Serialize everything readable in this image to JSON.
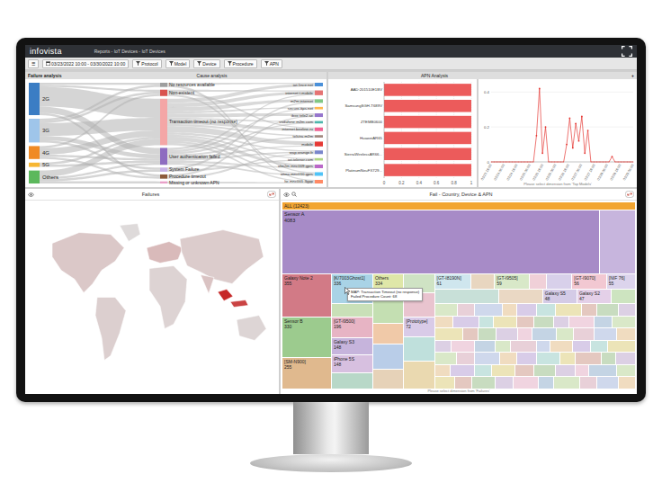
{
  "app": {
    "logo": "infovista",
    "title": "Reports - IoT Devices - IoT Devices"
  },
  "toolbar": {
    "menu": "☰",
    "date_range": "03/23/2022 10:00 - 03/30/2022 10:00",
    "filters": [
      "Protocol",
      "Model",
      "Device",
      "Procedure",
      "APN"
    ]
  },
  "sankey": {
    "title": "Failure analysis",
    "subtitle": "Cause analysis",
    "sources": [
      {
        "label": "2G",
        "color": "#3b7dc4",
        "flows": [
          1,
          1,
          9,
          3,
          0,
          1,
          0
        ]
      },
      {
        "label": "3G",
        "color": "#9fc5ea",
        "flows": [
          1,
          1,
          6,
          2,
          1,
          0,
          0
        ]
      },
      {
        "label": "4G",
        "color": "#f08a24",
        "flows": [
          0,
          1,
          3,
          1,
          0,
          1,
          0
        ]
      },
      {
        "label": "5G",
        "color": "#f7b733",
        "flows": [
          0,
          0,
          1,
          1,
          0,
          0,
          0
        ]
      },
      {
        "label": "Others",
        "color": "#5cb85c",
        "flows": [
          0,
          0,
          3,
          1,
          1,
          0,
          1
        ]
      }
    ],
    "causes": [
      {
        "label": "No resources available",
        "color": "#9e9e9e",
        "flows": [
          1,
          0,
          0,
          0,
          0,
          0,
          0,
          0,
          0,
          0,
          0,
          0,
          0,
          1
        ]
      },
      {
        "label": "Non-existent",
        "color": "#d9534f",
        "flows": [
          0,
          1,
          0,
          0,
          0,
          0,
          1,
          0,
          0,
          0,
          0,
          0,
          1,
          0
        ]
      },
      {
        "label": "Transaction timeout (no response)",
        "color": "#f4a6a6",
        "flows": [
          2,
          2,
          2,
          1,
          2,
          1,
          2,
          1,
          3,
          1,
          1,
          2,
          1,
          1
        ]
      },
      {
        "label": "User authentication failed",
        "color": "#8e6cc0",
        "flows": [
          0,
          1,
          0,
          1,
          0,
          1,
          0,
          1,
          1,
          1,
          0,
          1,
          1,
          0
        ]
      },
      {
        "label": "System Failure",
        "color": "#c9b3e6",
        "flows": [
          0,
          0,
          1,
          0,
          0,
          0,
          0,
          0,
          0,
          0,
          1,
          0,
          0,
          0
        ]
      },
      {
        "label": "Procedure timeout",
        "color": "#8d5a3b",
        "flows": [
          0,
          0,
          0,
          0,
          1,
          0,
          0,
          0,
          0,
          1,
          0,
          0,
          0,
          0
        ]
      },
      {
        "label": "Missing or unknown APN",
        "color": "#e8a0c8",
        "flows": [
          0,
          0,
          0,
          0,
          0,
          0,
          0,
          0,
          0,
          0,
          0,
          0,
          0,
          1
        ]
      }
    ],
    "apns": [
      {
        "label": "iot.1nce.net",
        "color": "#4a90d9"
      },
      {
        "label": "internet.t-mobile",
        "color": "#e57373"
      },
      {
        "label": "m2m.internet",
        "color": "#81c784"
      },
      {
        "label": "secure.ttps.net",
        "color": "#ffb74d"
      },
      {
        "label": "ibox.tele2.se",
        "color": "#9575cd"
      },
      {
        "label": "vodafone.m2m.com",
        "color": "#4db6ac"
      },
      {
        "label": "internet.beeline.ru",
        "color": "#f06292"
      },
      {
        "label": "telstra.m2m",
        "color": "#a1887f"
      },
      {
        "label": "mobile",
        "color": "#e53935"
      },
      {
        "label": "wap.orange.fr",
        "color": "#7986cb"
      },
      {
        "label": "iot.telenor.com",
        "color": "#aed581"
      },
      {
        "label": "vfm2m.mnc009.gprs",
        "color": "#ba68c8"
      },
      {
        "label": "wtmx.mnc010.gprs",
        "color": "#4fc3f7"
      },
      {
        "label": "lte.mnc001.3gpp",
        "color": "#ff8a65"
      }
    ]
  },
  "apn_panel": {
    "title": "APN Analysis",
    "add": "+"
  },
  "bar_chart": {
    "labels": [
      "AAD:201510E1BV",
      "SamsungSGH-T689V",
      "ZTEMB0600",
      "HuaweiAR65",
      "SierraWirelessAR66...",
      "PlatinumNeuFX729..."
    ],
    "values": [
      1,
      1,
      1,
      1,
      1,
      1
    ],
    "ticks": [
      "0",
      "0.2",
      "0.4",
      "0.6",
      "0.8",
      "1"
    ]
  },
  "line_chart": {
    "y_ticks": [
      "0",
      "0.2",
      "0.4"
    ],
    "x_ticks": [
      "03/23 18:00",
      "03/24 06:00",
      "03/24 18:00",
      "03/25 06:00",
      "03/25 18:00",
      "03/26 06:00",
      "03/26 18:00",
      "03/27 06:00",
      "03/27 18:00",
      "03/28 06:00",
      "03/28 18:00",
      "03/29 06:00"
    ],
    "values": [
      0,
      0,
      0,
      0,
      0,
      0,
      0,
      0,
      0,
      0,
      0,
      0,
      0,
      0,
      0,
      0.15,
      0.42,
      0.05,
      0.2,
      0,
      0,
      0,
      0,
      0,
      0,
      0.1,
      0.25,
      0.08,
      0.22,
      0.12,
      0.26,
      0.05,
      0.18,
      0,
      0,
      0,
      0,
      0,
      0,
      0,
      0.03,
      0,
      0,
      0,
      0,
      0,
      0,
      0
    ],
    "caption": "Please select dimension from 'Top Models'"
  },
  "map": {
    "title": "Failures",
    "regions": [
      {
        "level": 0.12
      },
      {
        "level": 0.02
      },
      {
        "level": 0.08
      },
      {
        "level": 0.2
      },
      {
        "level": 0.06
      },
      {
        "level": 0.1
      },
      {
        "level": 0.15
      },
      {
        "level": 1
      },
      {
        "level": 0.85
      },
      {
        "level": 0.05
      }
    ]
  },
  "treemap": {
    "title": "Fail - Country, Device & APN",
    "root": "ALL (12423)",
    "top": [
      {
        "label": "Sensor A",
        "count": "4083",
        "weight": 618,
        "color": "#a78bc7"
      },
      {
        "weight": 62,
        "color": "#c7b5dd"
      }
    ],
    "columns": [
      {
        "weight": 55,
        "cells": [
          {
            "label": "Galaxy Note 2",
            "count": "355",
            "weight": 47,
            "color": "#d27a86"
          },
          {
            "label": "Sensor B",
            "count": "330",
            "weight": 44,
            "color": "#9ccb8e"
          },
          {
            "label": "[SM-N900]",
            "count": "255",
            "weight": 34,
            "color": "#e0b98e"
          }
        ]
      },
      {
        "weight": 46,
        "cells": [
          {
            "label": "[K/7003Ghost1]",
            "count": "336",
            "weight": 34,
            "color": "#a9d3e6"
          },
          {
            "weight": 14,
            "color": "#c9e0b8"
          },
          {
            "label": "[GT-I9500]",
            "count": "196",
            "weight": 22,
            "color": "#e7b4c4"
          },
          {
            "label": "Galaxy S3",
            "count": "148",
            "weight": 19,
            "color": "#c6b4dc"
          },
          {
            "label": "iPhone 5S",
            "count": "148",
            "weight": 19,
            "color": "#d7c0e0"
          },
          {
            "weight": 17,
            "color": "#b8d8c8"
          }
        ]
      },
      {
        "weight": 34,
        "cells": [
          {
            "label": "Others",
            "count": "334",
            "weight": 28,
            "color": "#dfe7a8"
          },
          {
            "weight": 26,
            "color": "#c4dfb2"
          },
          {
            "weight": 22,
            "color": "#f0c9a8"
          },
          {
            "weight": 28,
            "color": "#b9cde8"
          },
          {
            "weight": 21,
            "color": "#e6d2b8"
          }
        ]
      },
      {
        "weight": 34,
        "cells": [
          {
            "weight": 20,
            "color": "#cfe3c4"
          },
          {
            "weight": 26,
            "color": "#e9c4cf"
          },
          {
            "label": "[Prototype]",
            "count": "72",
            "weight": 22,
            "color": "#d9cbe8"
          },
          {
            "weight": 26,
            "color": "#bfe0dc"
          },
          {
            "weight": 31,
            "color": "#ead9b0"
          }
        ]
      }
    ],
    "rest_weight": 227,
    "medium_rows": [
      [
        {
          "label": "[GT-I8190N]",
          "count": "61",
          "weight": 34,
          "color": "#cfe6ee"
        },
        {
          "weight": 20,
          "color": "#e8d6c0"
        },
        {
          "label": "[GT-I9505]",
          "count": "59",
          "weight": 32,
          "color": "#d8e8c8"
        },
        {
          "weight": 14,
          "color": "#f0d0d8"
        },
        {
          "weight": 22,
          "color": "#d8d0ea"
        },
        {
          "label": "[GT-I9070]",
          "count": "56",
          "weight": 32,
          "color": "#f2c8d2"
        },
        {
          "label": "[NIF 76]",
          "count": "55",
          "weight": 26,
          "color": "#dcd4ec"
        }
      ],
      [
        {
          "weight": 60,
          "color": "#c8e0d8"
        },
        {
          "weight": 40,
          "color": "#ead8c4"
        },
        {
          "label": "Galaxy S5",
          "count": "48",
          "weight": 30,
          "color": "#d4cbe6"
        },
        {
          "label": "Galaxy S2",
          "count": "47",
          "weight": 30,
          "color": "#e4d0e8"
        },
        {
          "weight": 20,
          "color": "#cde4c0"
        }
      ]
    ],
    "small_rows": [
      [
        12,
        8,
        15,
        6,
        10,
        9,
        14,
        7,
        11,
        8
      ],
      [
        9,
        14,
        6,
        12,
        8,
        10,
        7,
        13,
        9,
        12
      ],
      [
        15,
        7,
        9,
        11,
        6,
        13,
        8,
        10,
        12,
        9
      ],
      [
        8,
        12,
        10,
        7,
        14,
        6,
        11,
        9,
        8,
        15
      ],
      [
        11,
        9,
        13,
        8,
        10,
        12,
        7,
        14,
        6,
        10
      ],
      [
        7,
        13,
        8,
        12,
        9,
        11,
        10,
        6,
        15,
        9
      ],
      [
        10,
        8,
        12,
        9,
        13,
        7,
        14,
        8,
        11,
        8
      ]
    ],
    "tooltip": [
      "MAP: Transaction Timeout (no response)",
      "Failed Procedure Count: 68"
    ],
    "caption": "Please select dimension from 'Failures'"
  }
}
